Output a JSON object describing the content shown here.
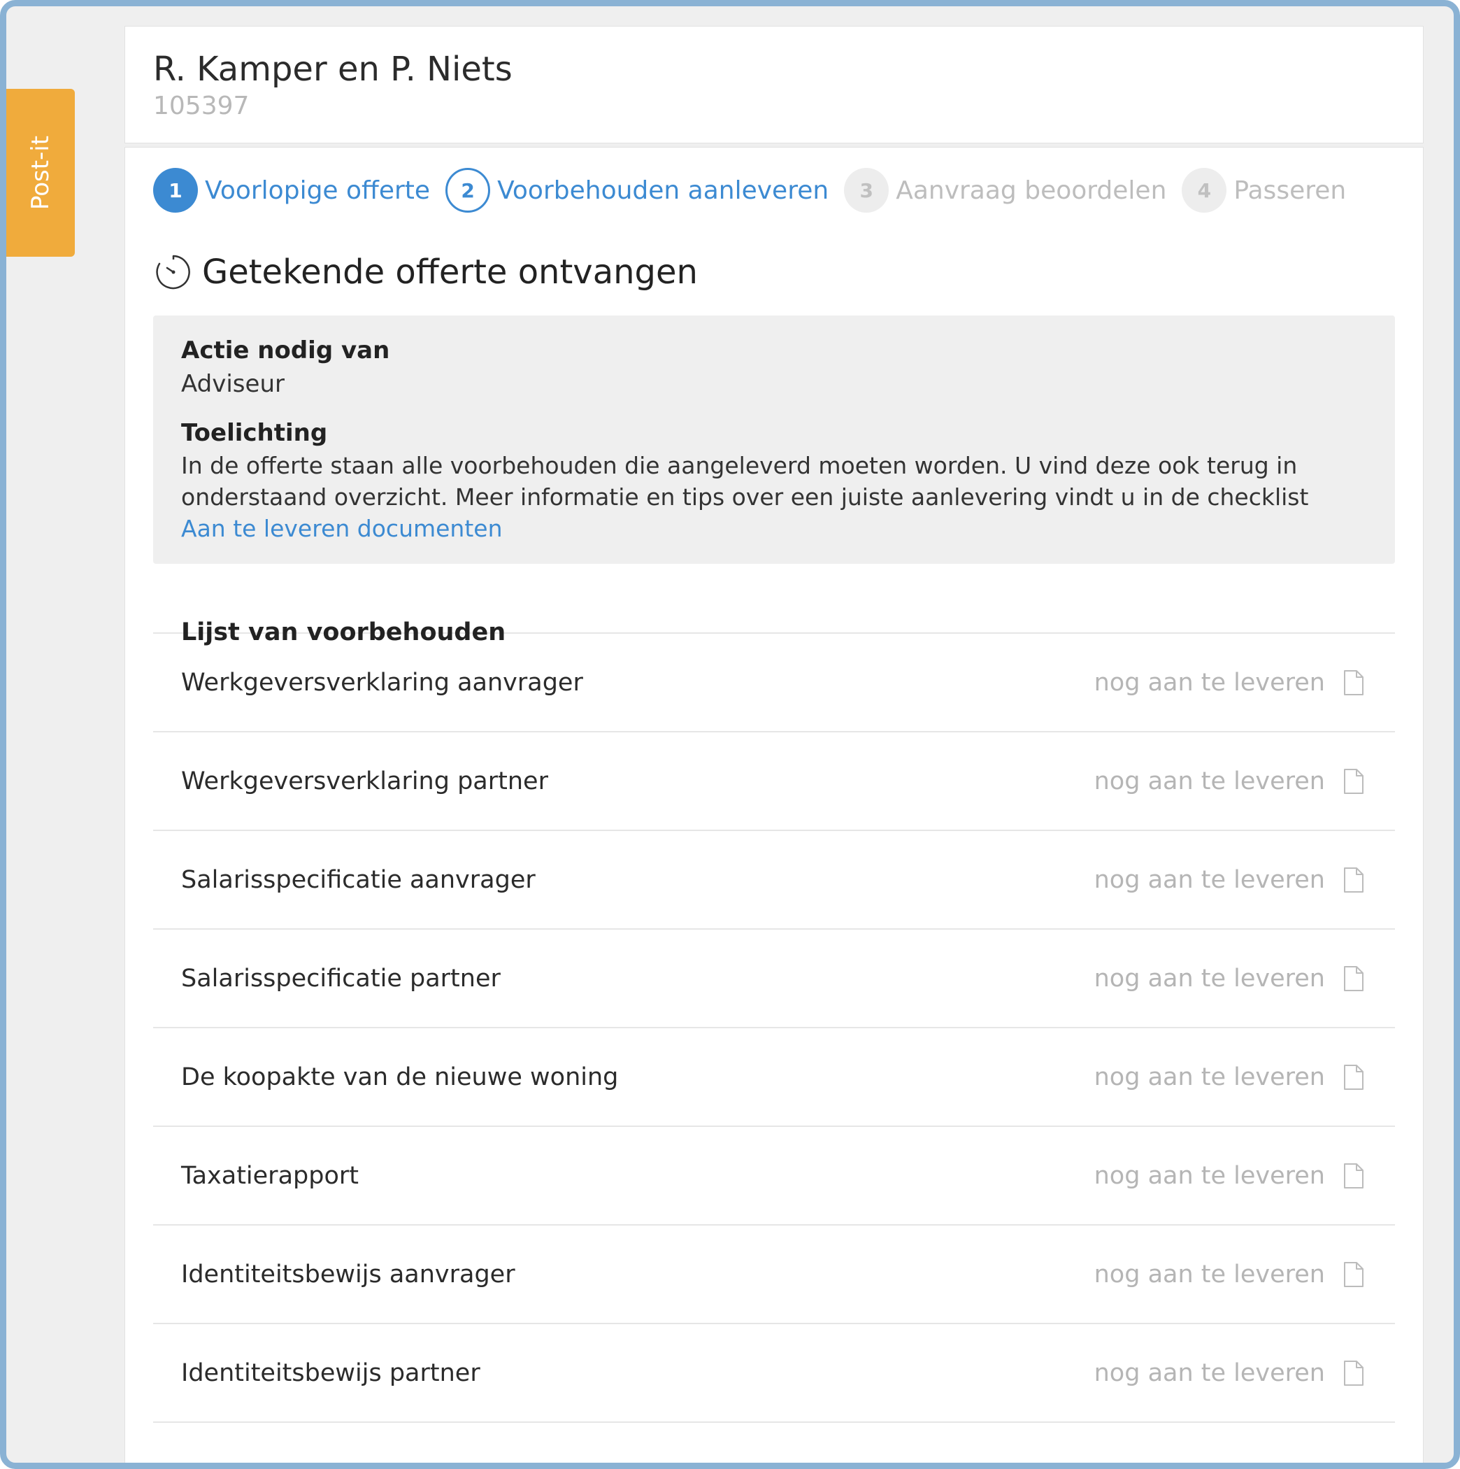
{
  "postit": {
    "label": "Post-it"
  },
  "client": {
    "name": "R. Kamper en P. Niets",
    "id": "105397"
  },
  "steps": [
    {
      "number": "1",
      "label": "Voorlopige offerte",
      "state": "done"
    },
    {
      "number": "2",
      "label": "Voorbehouden aanleveren",
      "state": "active"
    },
    {
      "number": "3",
      "label": "Aanvraag beoordelen",
      "state": "todo"
    },
    {
      "number": "4",
      "label": "Passeren",
      "state": "todo"
    }
  ],
  "section": {
    "title": "Getekende offerte ontvangen",
    "icon": "timer-icon"
  },
  "info": {
    "action_label": "Actie nodig van",
    "action_value": "Adviseur",
    "explanation_label": "Toelichting",
    "explanation_line1": "In de offerte staan alle voorbehouden die aangeleverd moeten worden. U vind deze ook terug in",
    "explanation_line2": "onderstaand overzicht. Meer informatie en tips over een juiste aanlevering vindt u in de checklist",
    "link_text": "Aan te leveren documenten"
  },
  "list": {
    "title": "Lijst van voorbehouden",
    "items": [
      {
        "label": "Werkgeversverklaring aanvrager",
        "status": "nog aan te leveren",
        "icon": "document-icon"
      },
      {
        "label": "Werkgeversverklaring partner",
        "status": "nog aan te leveren",
        "icon": "document-icon"
      },
      {
        "label": "Salarisspecificatie aanvrager",
        "status": "nog aan te leveren",
        "icon": "document-icon"
      },
      {
        "label": "Salarisspecificatie partner",
        "status": "nog aan te leveren",
        "icon": "document-icon"
      },
      {
        "label": "De koopakte van de nieuwe woning",
        "status": "nog aan te leveren",
        "icon": "document-icon"
      },
      {
        "label": "Taxatierapport",
        "status": "nog aan te leveren",
        "icon": "document-icon"
      },
      {
        "label": "Identiteitsbewijs aanvrager",
        "status": "nog aan te leveren",
        "icon": "document-icon"
      },
      {
        "label": "Identiteitsbewijs partner",
        "status": "nog aan te leveren",
        "icon": "document-icon"
      }
    ]
  },
  "colors": {
    "accent": "#3c8ad2",
    "postit": "#f0ab3c",
    "frame": "#8ab2d4"
  }
}
